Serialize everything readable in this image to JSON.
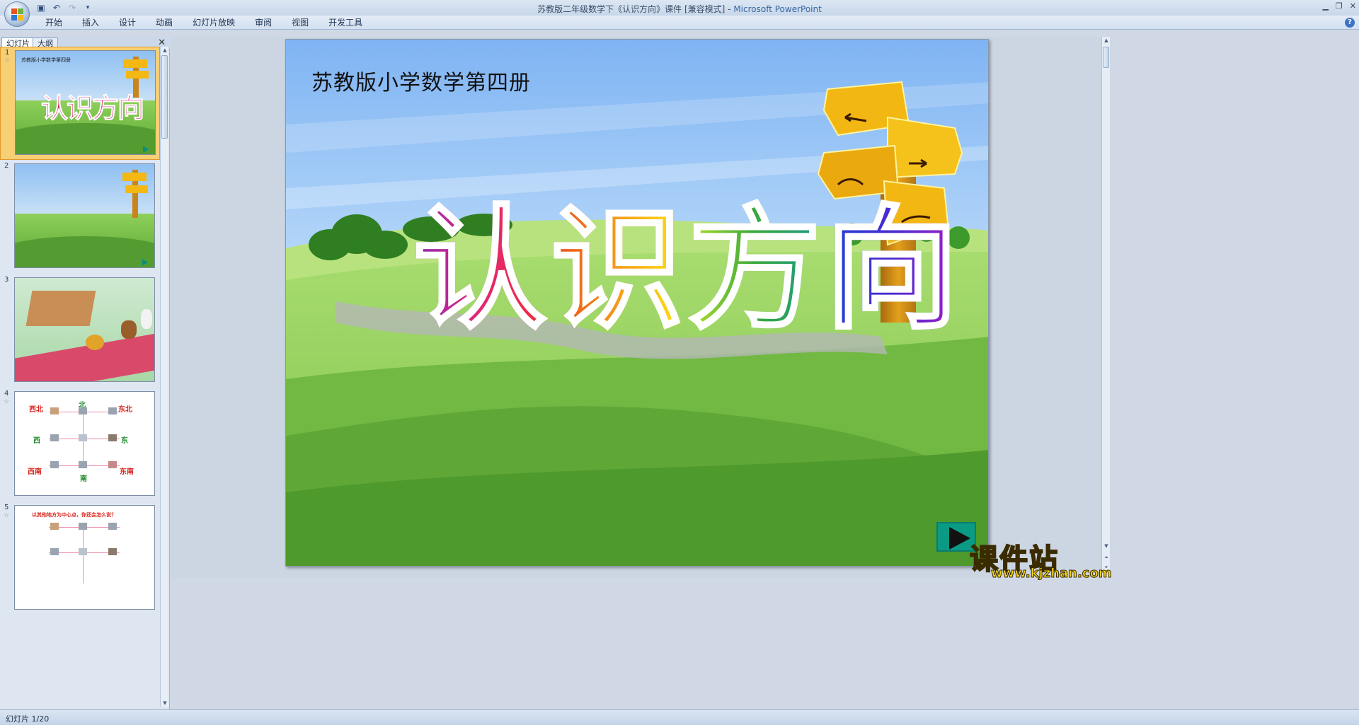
{
  "window": {
    "title": "苏教版二年级数学下《认识方向》课件 [兼容模式] - ",
    "app": "Microsoft PowerPoint"
  },
  "ribbon": {
    "tabs": [
      "开始",
      "插入",
      "设计",
      "动画",
      "幻灯片放映",
      "审阅",
      "视图",
      "开发工具"
    ]
  },
  "pane": {
    "tabs": [
      "幻灯片",
      "大纲"
    ],
    "thumbnails": [
      {
        "num": "1",
        "caption": "苏教版小学数学第四册",
        "title": "认识方向"
      },
      {
        "num": "2"
      },
      {
        "num": "3"
      },
      {
        "num": "4",
        "labels": {
          "nw": "西北",
          "n": "北",
          "ne": "东北",
          "w": "西",
          "e": "东",
          "sw": "西南",
          "s": "南",
          "se": "东南"
        }
      },
      {
        "num": "5",
        "caption": "以其他地方为中心点，你还会怎么说？"
      }
    ]
  },
  "slide": {
    "subtitle": "苏教版小学数学第四册",
    "title_chars": [
      "认",
      "识",
      "方",
      "向"
    ]
  },
  "statusbar": {
    "text": "幻灯片 1/20"
  },
  "watermark": {
    "name": "课件站",
    "url": "www.kjzhan.com"
  }
}
